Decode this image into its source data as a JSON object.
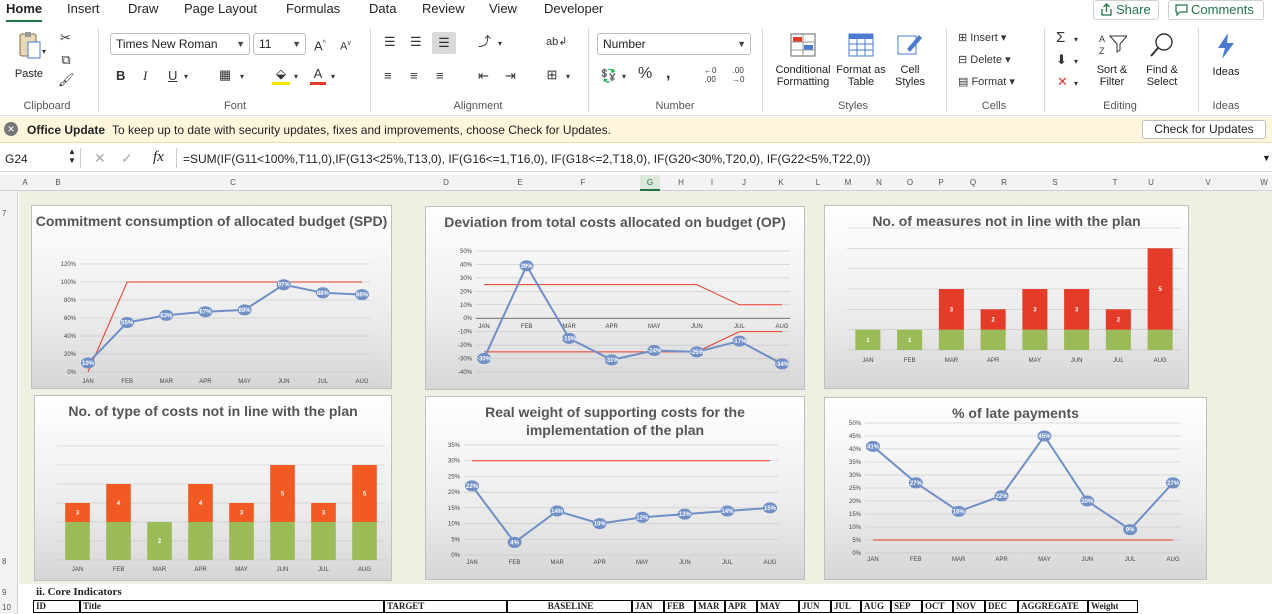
{
  "tabs": [
    "Home",
    "Insert",
    "Draw",
    "Page Layout",
    "Formulas",
    "Data",
    "Review",
    "View",
    "Developer"
  ],
  "share_label": "Share",
  "comments_label": "Comments",
  "ribbon": {
    "clipboard": {
      "paste": "Paste",
      "label": "Clipboard"
    },
    "font": {
      "name": "Times New Roman",
      "size": "11",
      "label": "Font",
      "bold": "B",
      "italic": "I",
      "underline": "U"
    },
    "alignment": {
      "label": "Alignment"
    },
    "number": {
      "format": "Number",
      "label": "Number",
      "percent": "%"
    },
    "styles": {
      "conditional": "Conditional Formatting",
      "format_table": "Format as Table",
      "cell_styles": "Cell Styles",
      "label": "Styles"
    },
    "cells": {
      "insert": "Insert",
      "delete": "Delete",
      "format": "Format",
      "label": "Cells"
    },
    "editing": {
      "sort": "Sort & Filter",
      "find": "Find & Select",
      "label": "Editing"
    },
    "ideas": {
      "btn": "Ideas",
      "label": "Ideas"
    }
  },
  "update": {
    "title": "Office Update",
    "msg": "To keep up to date with security updates, fixes and improvements, choose Check for Updates.",
    "button": "Check for Updates"
  },
  "formula": {
    "cell": "G24",
    "fx": "fx",
    "text": "=SUM(IF(G11<100%,T11,0),IF(G13<25%,T13,0), IF(G16<=1,T16,0), IF(G18<=2,T18,0), IF(G20<30%,T20,0), IF(G22<5%,T22,0))"
  },
  "columns": [
    "A",
    "B",
    "C",
    "D",
    "E",
    "F",
    "G",
    "H",
    "I",
    "J",
    "K",
    "L",
    "M",
    "N",
    "O",
    "P",
    "Q",
    "R",
    "S",
    "T",
    "U",
    "V",
    "W"
  ],
  "rows": [
    "7",
    "8",
    "9",
    "10"
  ],
  "section_title": "ii. Core Indicators",
  "table_headers": [
    "ID",
    "Title",
    "TARGET",
    "BASELINE",
    "JAN",
    "FEB",
    "MAR",
    "APR",
    "MAY",
    "JUN",
    "JUL",
    "AUG",
    "SEP",
    "OCT",
    "NOV",
    "DEC",
    "AGGREGATE",
    "Weight"
  ],
  "colors": {
    "accent": "#217346",
    "line": "#6f8fc6",
    "red": "#e53c2a",
    "green": "#9bbb59",
    "orange": "#f15a22"
  },
  "chart_data": [
    {
      "type": "line",
      "title": "Commitment  consumption of allocated budget (SPD)",
      "categories": [
        "JAN",
        "FEB",
        "MAR",
        "APR",
        "MAY",
        "JUN",
        "JUL",
        "AUG"
      ],
      "yticks": [
        "0%",
        "20%",
        "40%",
        "60%",
        "80%",
        "100%",
        "120%"
      ],
      "ylim": [
        0,
        120
      ],
      "series": [
        {
          "values": [
            10,
            55,
            63,
            67,
            69,
            97,
            88,
            86
          ],
          "labels": [
            "10%",
            "55%",
            "63%",
            "67%",
            "69%",
            "97%",
            "88%",
            "86%"
          ]
        },
        {
          "values": [
            0,
            100,
            100,
            100,
            100,
            100,
            100,
            100
          ]
        }
      ]
    },
    {
      "type": "line",
      "title": "Deviation from total costs allocated on budget (OP)",
      "categories": [
        "JAN",
        "FEB",
        "MAR",
        "APR",
        "MAY",
        "JUN",
        "JUL",
        "AUG"
      ],
      "yticks": [
        "-40%",
        "-30%",
        "-20%",
        "-10%",
        "0%",
        "10%",
        "20%",
        "30%",
        "40%",
        "50%"
      ],
      "ylim": [
        -40,
        50
      ],
      "series": [
        {
          "values": [
            -30,
            39,
            -15,
            -31,
            -24,
            -25,
            -17,
            -34
          ],
          "labels": [
            "-30%",
            "39%",
            "-15%",
            "-31%",
            "-24%",
            "-25%",
            "-17%",
            "-34%"
          ]
        },
        {
          "values": [
            25,
            25,
            25,
            25,
            25,
            25,
            10,
            10
          ]
        },
        {
          "values": [
            -25,
            -25,
            -25,
            -25,
            -25,
            -25,
            -10,
            -10
          ]
        }
      ]
    },
    {
      "type": "bar",
      "title": "No. of measures not in line with the plan",
      "categories": [
        "JAN",
        "FEB",
        "MAR",
        "APR",
        "MAY",
        "JUN",
        "JUL",
        "AUG"
      ],
      "ylim": [
        0,
        6
      ],
      "series": [
        {
          "values": [
            1,
            1,
            1,
            1,
            1,
            1,
            1,
            1
          ],
          "labels": [
            "1",
            "1",
            "",
            "",
            "",
            "",
            "",
            ""
          ]
        },
        {
          "values": [
            0,
            0,
            2,
            1,
            2,
            2,
            1,
            4
          ],
          "labels": [
            "",
            "",
            "3",
            "2",
            "3",
            "3",
            "2",
            "5"
          ]
        }
      ]
    },
    {
      "type": "bar",
      "title": "No. of type of costs not in line with the plan",
      "categories": [
        "JAN",
        "FEB",
        "MAR",
        "APR",
        "MAY",
        "JUN",
        "JUL",
        "AUG"
      ],
      "ylim": [
        0,
        6
      ],
      "series": [
        {
          "values": [
            2,
            2,
            2,
            2,
            2,
            2,
            2,
            2
          ],
          "labels": [
            "",
            "",
            "2",
            "",
            "",
            "",
            "",
            ""
          ]
        },
        {
          "values": [
            1,
            2,
            0,
            2,
            1,
            3,
            1,
            3
          ],
          "labels": [
            "3",
            "4",
            "",
            "4",
            "3",
            "5",
            "3",
            "5"
          ]
        }
      ]
    },
    {
      "type": "line",
      "title": "Real weight of supporting costs for the implementation of the plan",
      "categories": [
        "JAN",
        "FEB",
        "MAR",
        "APR",
        "MAY",
        "JUN",
        "JUL",
        "AUG"
      ],
      "yticks": [
        "0%",
        "5%",
        "10%",
        "15%",
        "20%",
        "25%",
        "30%",
        "35%"
      ],
      "ylim": [
        0,
        35
      ],
      "series": [
        {
          "values": [
            22,
            4,
            14,
            10,
            12,
            13,
            14,
            15
          ],
          "labels": [
            "22%",
            "4%",
            "14%",
            "10%",
            "12%",
            "13%",
            "14%",
            "15%"
          ]
        },
        {
          "values": [
            30,
            30,
            30,
            30,
            30,
            30,
            30,
            30
          ]
        }
      ]
    },
    {
      "type": "line",
      "title": "% of late payments",
      "categories": [
        "JAN",
        "FEB",
        "MAR",
        "APR",
        "MAY",
        "JUN",
        "JUL",
        "AUG"
      ],
      "yticks": [
        "0%",
        "5%",
        "10%",
        "15%",
        "20%",
        "25%",
        "30%",
        "35%",
        "40%",
        "45%",
        "50%"
      ],
      "ylim": [
        0,
        50
      ],
      "series": [
        {
          "values": [
            41,
            27,
            16,
            22,
            45,
            20,
            9,
            27
          ],
          "labels": [
            "41%",
            "27%",
            "16%",
            "22%",
            "45%",
            "20%",
            "9%",
            "27%"
          ]
        },
        {
          "values": [
            5,
            5,
            5,
            5,
            5,
            5,
            5,
            5
          ]
        }
      ]
    }
  ]
}
